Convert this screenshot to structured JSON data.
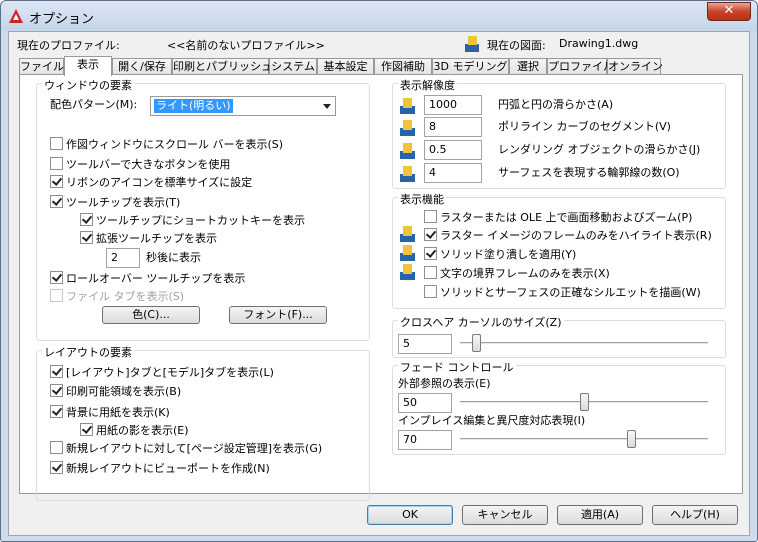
{
  "window": {
    "title": "オプション",
    "close_label": "✕"
  },
  "profile": {
    "label": "現在のプロファイル:",
    "value": "<<名前のないプロファイル>>",
    "drawing_label": "現在の図面:",
    "drawing_value": "Drawing1.dwg"
  },
  "tabs": [
    "ファイル",
    "表示",
    "開く/保存",
    "印刷とパブリッシュ",
    "システム",
    "基本設定",
    "作図補助",
    "3D モデリング",
    "選択",
    "プロファイル",
    "オンライン"
  ],
  "window_elements": {
    "legend": "ウィンドウの要素",
    "color_scheme_label": "配色パターン(M):",
    "color_scheme_value": "ライト(明るい)",
    "scrollbars": "作図ウィンドウにスクロール バーを表示(S)",
    "large_buttons": "ツールバーで大きなボタンを使用",
    "ribbon_icons": "リボンのアイコンを標準サイズに設定",
    "tooltips": "ツールチップを表示(T)",
    "shortcut_keys": "ツールチップにショートカットキーを表示",
    "extended_tooltips": "拡張ツールチップを表示",
    "delay_value": "2",
    "delay_label": "秒後に表示",
    "rollover": "ロールオーバー ツールチップを表示",
    "file_tabs": "ファイル タブを表示(S)",
    "colors_button": "色(C)...",
    "fonts_button": "フォント(F)..."
  },
  "layout_elements": {
    "legend": "レイアウトの要素",
    "layout_model_tabs": "[レイアウト]タブと[モデル]タブを表示(L)",
    "printable_area": "印刷可能領域を表示(B)",
    "paper_background": "背景に用紙を表示(K)",
    "paper_shadow": "用紙の影を表示(E)",
    "page_setup_manager": "新規レイアウトに対して[ページ設定管理]を表示(G)",
    "create_viewport": "新規レイアウトにビューポートを作成(N)"
  },
  "display_resolution": {
    "legend": "表示解像度",
    "arc_value": "1000",
    "arc_label": "円弧と円の滑らかさ(A)",
    "polyline_value": "8",
    "polyline_label": "ポリライン カーブのセグメント(V)",
    "render_value": "0.5",
    "render_label": "レンダリング オブジェクトの滑らかさ(J)",
    "contour_value": "4",
    "contour_label": "サーフェスを表現する輪郭線の数(O)"
  },
  "display_performance": {
    "legend": "表示機能",
    "raster_pan": "ラスターまたは OLE 上で画面移動およびズーム(P)",
    "raster_frame": "ラスター イメージのフレームのみをハイライト表示(R)",
    "solid_fill": "ソリッド塗り潰しを適用(Y)",
    "text_frame": "文字の境界フレームのみを表示(X)",
    "silhouette": "ソリッドとサーフェスの正確なシルエットを描画(W)"
  },
  "crosshair": {
    "legend": "クロスヘア カーソルのサイズ(Z)",
    "value": "5",
    "level": 5
  },
  "fade": {
    "legend": "フェード コントロール",
    "xref_label": "外部参照の表示(E)",
    "xref_value": "50",
    "xref_level": 50,
    "inplace_label": "インプレイス編集と異尺度対応表現(I)",
    "inplace_value": "70",
    "inplace_level": 70
  },
  "buttons": {
    "ok": "OK",
    "cancel": "キャンセル",
    "apply": "適用(A)",
    "help": "ヘルプ(H)"
  },
  "colors": {
    "accent": "#3399ff",
    "close": "#c7442b"
  }
}
